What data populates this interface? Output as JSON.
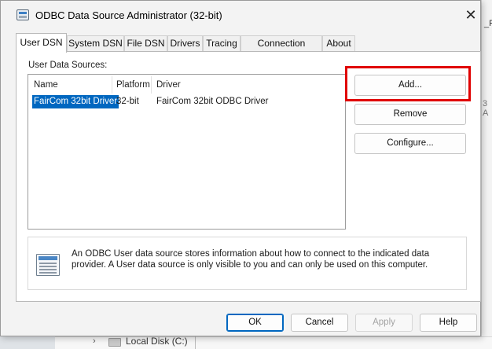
{
  "window": {
    "title": "ODBC Data Source Administrator (32-bit)",
    "close_symbol": "✕"
  },
  "tabs": [
    {
      "label": "User DSN",
      "active": true
    },
    {
      "label": "System DSN"
    },
    {
      "label": "File DSN"
    },
    {
      "label": "Drivers"
    },
    {
      "label": "Tracing"
    },
    {
      "label": "Connection Pooling"
    },
    {
      "label": "About"
    }
  ],
  "user_dsn": {
    "group_label": "User Data Sources:",
    "columns": [
      "Name",
      "Platform",
      "Driver"
    ],
    "rows": [
      {
        "name": "FairCom 32bit Driver",
        "platform": "32-bit",
        "driver": "FairCom 32bit ODBC Driver",
        "selected": true
      }
    ],
    "buttons": {
      "add": "Add...",
      "remove": "Remove",
      "configure": "Configure..."
    },
    "info_text": "An ODBC User data source stores information about how to connect to the indicated data provider.   A User data source is only visible to you and can only be used on this computer."
  },
  "footer_buttons": {
    "ok": "OK",
    "cancel": "Cancel",
    "apply": "Apply",
    "help": "Help"
  },
  "background": {
    "right_text_top": "_Fi",
    "right_text_mid": "3 A",
    "drive_label": "Local Disk (C:)",
    "chevron": "›"
  },
  "colors": {
    "selection": "#0067c0",
    "highlight_box": "#e00000",
    "dialog_bg": "#f3f3f3"
  },
  "icons": {
    "app": "odbc-admin-icon",
    "info": "data-source-icon",
    "close": "close-icon"
  }
}
